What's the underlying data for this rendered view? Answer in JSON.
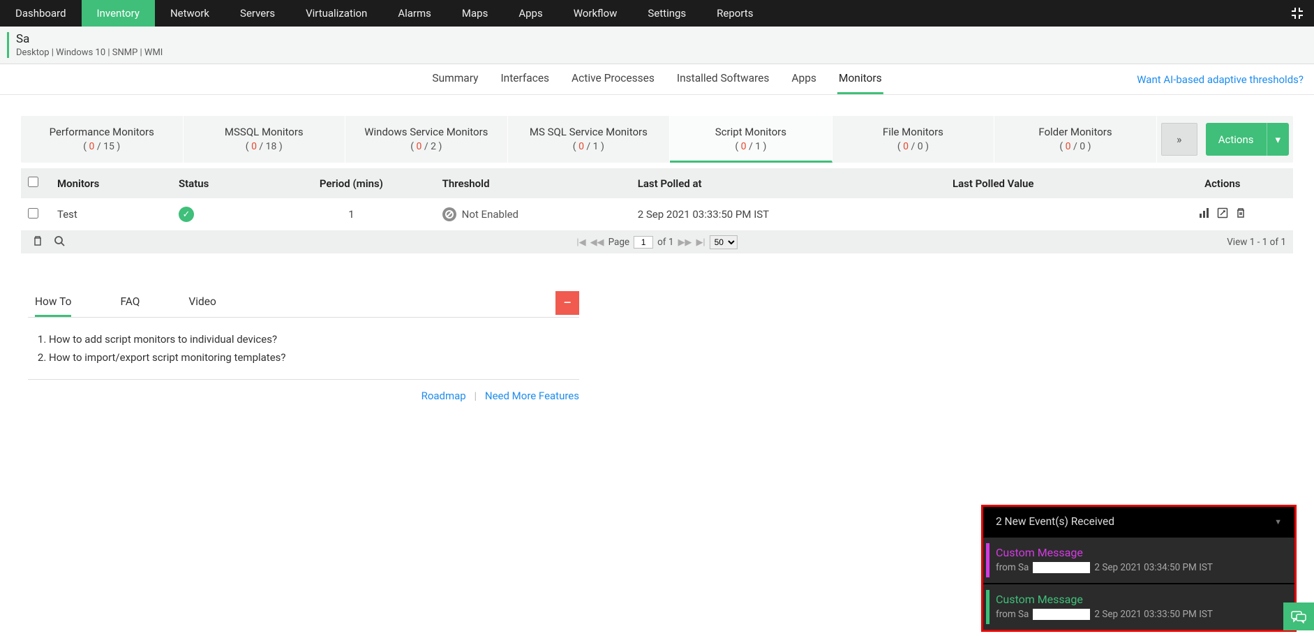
{
  "topnav": {
    "items": [
      "Dashboard",
      "Inventory",
      "Network",
      "Servers",
      "Virtualization",
      "Alarms",
      "Maps",
      "Apps",
      "Workflow",
      "Settings",
      "Reports"
    ],
    "active_index": 1
  },
  "header": {
    "title": "Sa",
    "meta": "Desktop | Windows 10  | SNMP  | WMI"
  },
  "subtabs": {
    "items": [
      "Summary",
      "Interfaces",
      "Active Processes",
      "Installed Softwares",
      "Apps",
      "Monitors"
    ],
    "active_index": 5,
    "cta": "Want AI-based adaptive thresholds?"
  },
  "monitor_tabs": [
    {
      "label": "Performance Monitors",
      "red": "0",
      "total": "15"
    },
    {
      "label": "MSSQL Monitors",
      "red": "0",
      "total": "18"
    },
    {
      "label": "Windows Service Monitors",
      "red": "0",
      "total": "2"
    },
    {
      "label": "MS SQL Service Monitors",
      "red": "0",
      "total": "1"
    },
    {
      "label": "Script Monitors",
      "red": "0",
      "total": "1"
    },
    {
      "label": "File Monitors",
      "red": "0",
      "total": "0"
    },
    {
      "label": "Folder Monitors",
      "red": "0",
      "total": "0"
    }
  ],
  "monitor_tabs_active": 4,
  "actions_label": "Actions",
  "table": {
    "headers": [
      "",
      "Monitors",
      "Status",
      "Period (mins)",
      "Threshold",
      "Last Polled at",
      "Last Polled Value",
      "Actions"
    ],
    "rows": [
      {
        "name": "Test",
        "period": "1",
        "threshold": "Not Enabled",
        "polled_at": "2 Sep 2021 03:33:50 PM IST"
      }
    ]
  },
  "pager": {
    "page": "1",
    "of": "of 1",
    "pagesize": "50",
    "view": "View 1 - 1 of 1",
    "page_label": "Page"
  },
  "help": {
    "tabs": [
      "How To",
      "FAQ",
      "Video"
    ],
    "active_index": 0,
    "items": [
      "How to add script monitors to individual devices?",
      "How to import/export script monitoring templates?"
    ],
    "roadmap": "Roadmap",
    "need_more": "Need More Features"
  },
  "events": {
    "header": "2 New Event(s) Received",
    "items": [
      {
        "title": "Custom Message",
        "from_prefix": "from Sa",
        "time": "2 Sep 2021 03:34:50 PM IST",
        "color": "c1",
        "stripe": "p1"
      },
      {
        "title": "Custom Message",
        "from_prefix": "from Sa",
        "time": "2 Sep 2021 03:33:50 PM IST",
        "color": "c2",
        "stripe": "p2"
      }
    ]
  }
}
